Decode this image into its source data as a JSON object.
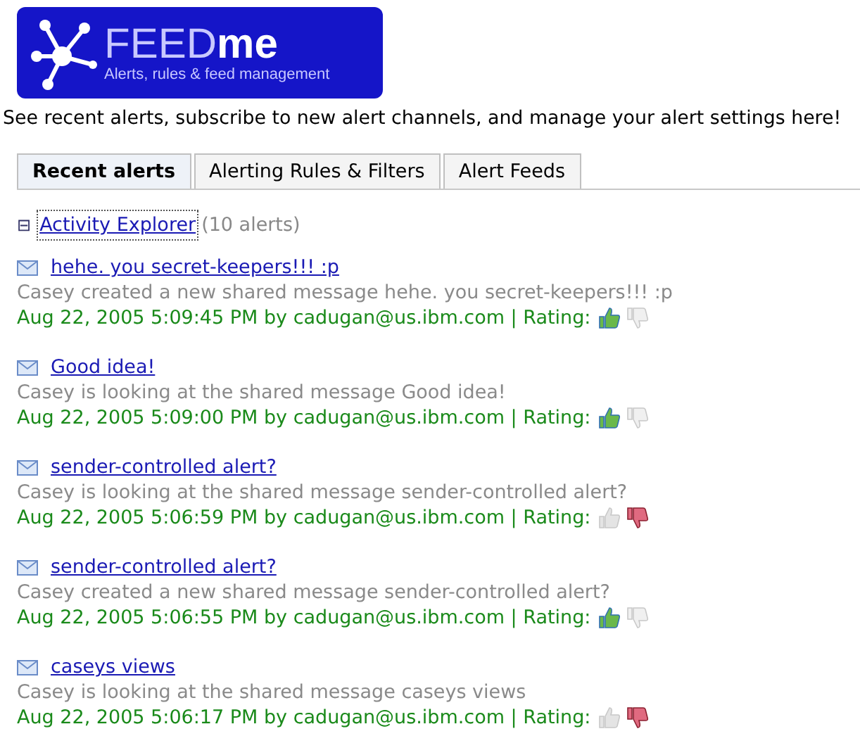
{
  "logo": {
    "title_light": "FEED",
    "title_bold": "me",
    "subtitle": "Alerts, rules & feed management"
  },
  "intro": "See recent alerts, subscribe to new alert channels, and manage your alert settings here!",
  "tabs": [
    {
      "label": "Recent alerts",
      "selected": true
    },
    {
      "label": "Alerting Rules & Filters",
      "selected": false
    },
    {
      "label": "Alert Feeds",
      "selected": false
    }
  ],
  "group": {
    "toggle": "⊟",
    "label": "Activity Explorer",
    "count": "(10 alerts)",
    "expanded": true
  },
  "alerts": [
    {
      "title": "hehe. you secret-keepers!!! :p",
      "description": "Casey created a new shared message hehe. you secret-keepers!!! :p",
      "meta": "Aug 22, 2005 5:09:45 PM by cadugan@us.ibm.com | Rating:",
      "liked": true,
      "disliked": false
    },
    {
      "title": "Good idea!",
      "description": "Casey is looking at the shared message Good idea!",
      "meta": "Aug 22, 2005 5:09:00 PM by cadugan@us.ibm.com | Rating:",
      "liked": true,
      "disliked": false
    },
    {
      "title": "sender-controlled alert?",
      "description": "Casey is looking at the shared message sender-controlled alert?",
      "meta": "Aug 22, 2005 5:06:59 PM by cadugan@us.ibm.com | Rating:",
      "liked": false,
      "disliked": true
    },
    {
      "title": "sender-controlled alert?",
      "description": "Casey created a new shared message sender-controlled alert?",
      "meta": "Aug 22, 2005 5:06:55 PM by cadugan@us.ibm.com | Rating:",
      "liked": true,
      "disliked": false
    },
    {
      "title": "caseys views",
      "description": "Casey is looking at the shared message caseys views",
      "meta": "Aug 22, 2005 5:06:17 PM by cadugan@us.ibm.com | Rating:",
      "liked": false,
      "disliked": true
    }
  ]
}
